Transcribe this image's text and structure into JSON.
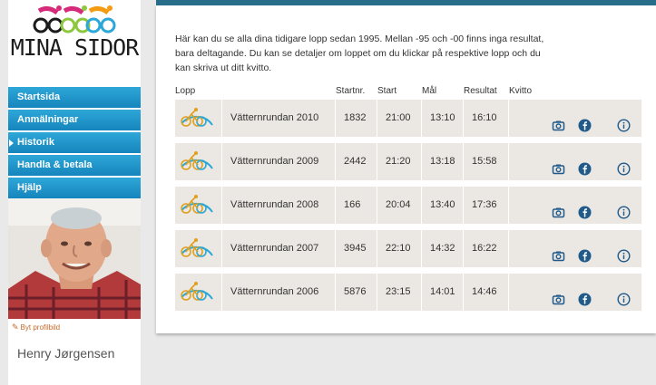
{
  "logo": {
    "text": "MINA SIDOR"
  },
  "nav": [
    {
      "label": "Startsida",
      "active": false
    },
    {
      "label": "Anmälningar",
      "active": false
    },
    {
      "label": "Historik",
      "active": true
    },
    {
      "label": "Handla & betala",
      "active": false
    },
    {
      "label": "Hjälp",
      "active": false
    }
  ],
  "profile": {
    "change_picture": "Byt profilbild",
    "name": "Henry Jørgensen"
  },
  "main": {
    "intro": "Här kan du se alla dina tidigare lopp sedan 1995. Mellan -95 och -00 finns inga resultat, bara deltagande. Du kan se detaljer om loppet om du klickar på respektive lopp och du kan skriva ut ditt kvitto.",
    "headers": {
      "race": "Lopp",
      "bib": "Startnr.",
      "start": "Start",
      "finish": "Mål",
      "result": "Resultat",
      "receipt": "Kvitto"
    },
    "rows": [
      {
        "name": "Vätternrundan 2010",
        "bib": "1832",
        "start": "21:00",
        "finish": "13:10",
        "result": "16:10"
      },
      {
        "name": "Vätternrundan 2009",
        "bib": "2442",
        "start": "21:20",
        "finish": "13:18",
        "result": "15:58"
      },
      {
        "name": "Vätternrundan 2008",
        "bib": "166",
        "start": "20:04",
        "finish": "13:40",
        "result": "17:36"
      },
      {
        "name": "Vätternrundan 2007",
        "bib": "3945",
        "start": "22:10",
        "finish": "14:32",
        "result": "16:22"
      },
      {
        "name": "Vätternrundan 2006",
        "bib": "5876",
        "start": "23:15",
        "finish": "14:01",
        "result": "14:46"
      }
    ],
    "row_icons": [
      "camera-icon",
      "facebook-icon",
      "info-icon"
    ]
  },
  "colors": {
    "nav_blue": "#1a8fc8",
    "accent_orange": "#c46a2a",
    "row_bg": "#ebe7e2",
    "icon_blue": "#1f5a8a",
    "top_strip": "#286e8a"
  }
}
